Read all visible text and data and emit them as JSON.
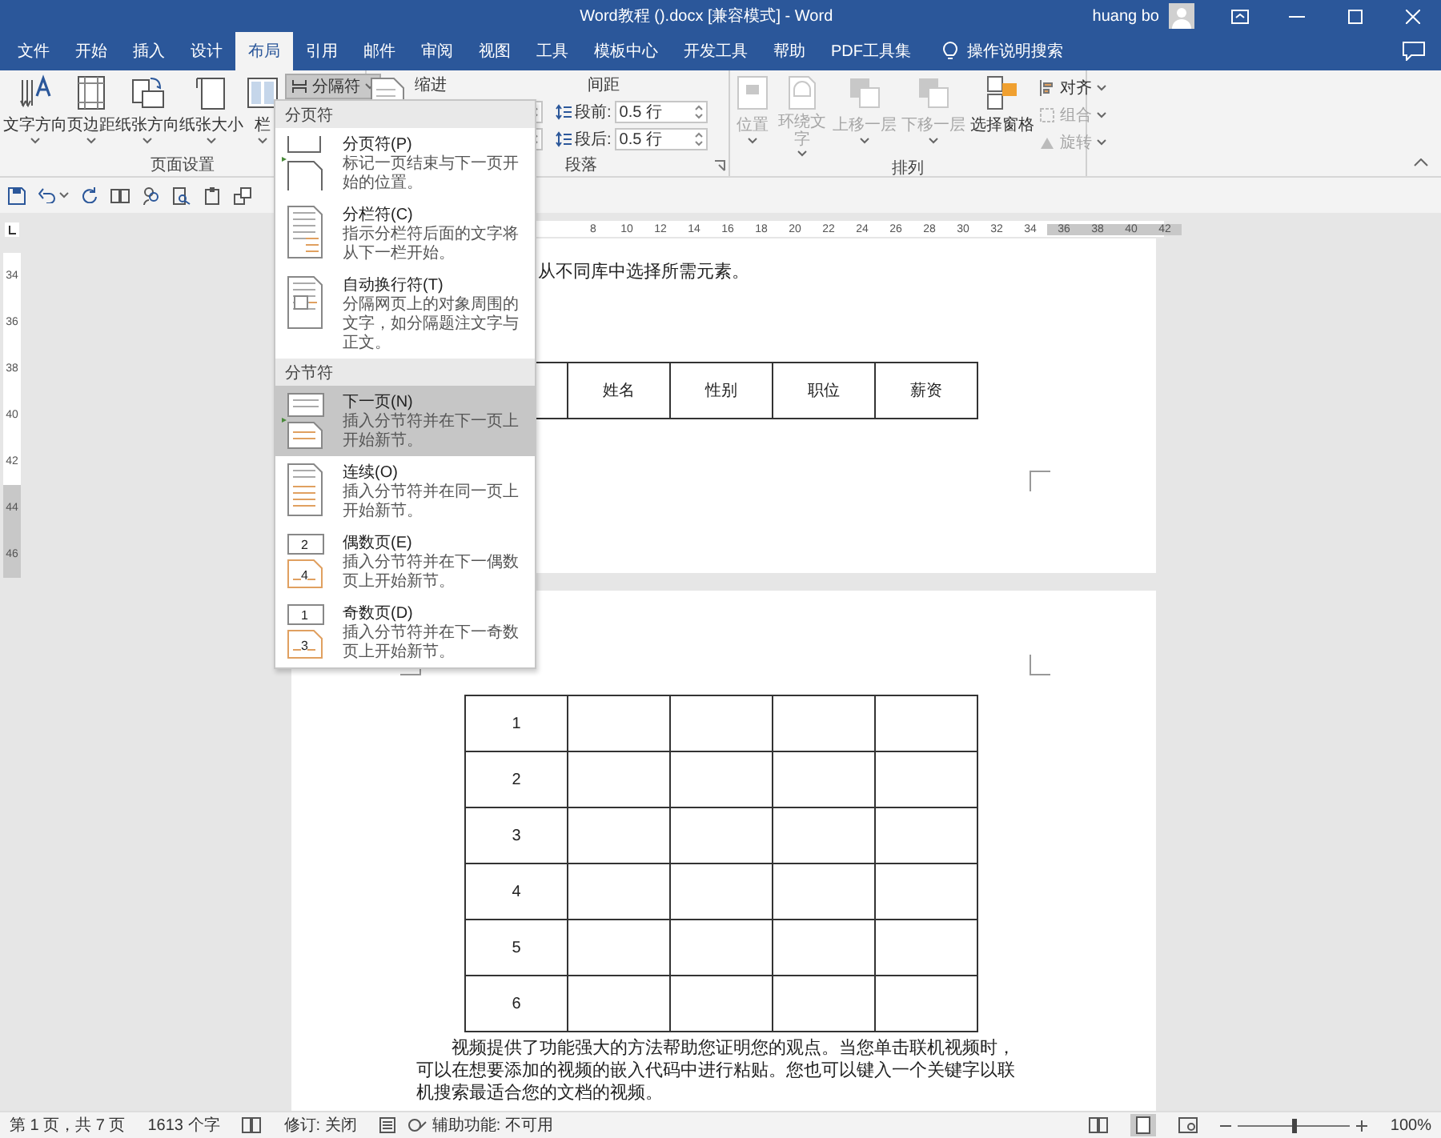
{
  "window": {
    "title": "Word教程 ().docx [兼容模式] - Word",
    "user": "huang bo"
  },
  "tabs": [
    {
      "label": "文件",
      "selected": false
    },
    {
      "label": "开始",
      "selected": false
    },
    {
      "label": "插入",
      "selected": false
    },
    {
      "label": "设计",
      "selected": false
    },
    {
      "label": "布局",
      "selected": true
    },
    {
      "label": "引用",
      "selected": false
    },
    {
      "label": "邮件",
      "selected": false
    },
    {
      "label": "审阅",
      "selected": false
    },
    {
      "label": "视图",
      "selected": false
    },
    {
      "label": "工具",
      "selected": false
    },
    {
      "label": "模板中心",
      "selected": false
    },
    {
      "label": "开发工具",
      "selected": false
    },
    {
      "label": "帮助",
      "selected": false
    },
    {
      "label": "PDF工具集",
      "selected": false
    }
  ],
  "tell_me": "操作说明搜索",
  "page_setup": {
    "label": "页面设置",
    "buttons": [
      "文字方向",
      "页边距",
      "纸张方向",
      "纸张大小",
      "栏"
    ],
    "breaks": "分隔符"
  },
  "paragraph": {
    "label": "段落",
    "indent": "缩进",
    "spacing": "间距",
    "spacing_fields": [
      {
        "label": "段前:",
        "value": "0.5 行"
      },
      {
        "label": "段后:",
        "value": "0.5 行"
      }
    ]
  },
  "arrange": {
    "label": "排列",
    "buttons": [
      {
        "label": "位置",
        "disabled": true
      },
      {
        "label": "环绕文字",
        "disabled": true
      },
      {
        "label": "上移一层",
        "disabled": true
      },
      {
        "label": "下移一层",
        "disabled": true
      },
      {
        "label": "选择窗格",
        "disabled": false
      }
    ],
    "small_buttons": [
      {
        "label": "对齐",
        "disabled": false
      },
      {
        "label": "组合",
        "disabled": true
      },
      {
        "label": "旋转",
        "disabled": true
      }
    ]
  },
  "breaks_menu": {
    "sections": [
      {
        "heading": "分页符",
        "items": [
          {
            "title": "分页符(P)",
            "description": "标记一页结束与下一页开始的位置。",
            "selected": false
          },
          {
            "title": "分栏符(C)",
            "description": "指示分栏符后面的文字将从下一栏开始。",
            "selected": false
          },
          {
            "title": "自动换行符(T)",
            "description": "分隔网页上的对象周围的文字，如分隔题注文字与正文。",
            "selected": false
          }
        ]
      },
      {
        "heading": "分节符",
        "items": [
          {
            "title": "下一页(N)",
            "description": "插入分节符并在下一页上开始新节。",
            "selected": true
          },
          {
            "title": "连续(O)",
            "description": "插入分节符并在同一页上开始新节。",
            "selected": false
          },
          {
            "title": "偶数页(E)",
            "description": "插入分节符并在下一偶数页上开始新节。",
            "selected": false,
            "icon_labels": [
              "2",
              "4"
            ]
          },
          {
            "title": "奇数页(D)",
            "description": "插入分节符并在下一奇数页上开始新节。",
            "selected": false,
            "icon_labels": [
              "1",
              "3"
            ]
          }
        ]
      }
    ]
  },
  "ruler": {
    "horizontal": [
      "8",
      "10",
      "12",
      "14",
      "16",
      "18",
      "20",
      "22",
      "24",
      "26",
      "28",
      "30",
      "32",
      "34",
      "36",
      "38",
      "40",
      "42"
    ],
    "vertical": [
      "34",
      "36",
      "38",
      "40",
      "42",
      "44",
      "46"
    ]
  },
  "page1": {
    "text": "从不同库中选择所需元素。",
    "table_header": [
      "姓名",
      "性别",
      "职位",
      "薪资"
    ]
  },
  "page2": {
    "row_numbers": [
      "1",
      "2",
      "3",
      "4",
      "5",
      "6"
    ],
    "paragraph": "视频提供了功能强大的方法帮助您证明您的观点。当您单击联机视频时，可以在想要添加的视频的嵌入代码中进行粘贴。您也可以键入一个关键字以联机搜索最适合您的文档的视频。"
  },
  "status_bar": {
    "page": "第 1 页，共 7 页",
    "words": "1613 个字",
    "track_changes": "修订: 关闭",
    "accessibility": "辅助功能: 不可用",
    "zoom": "100%",
    "zoom_slider": {
      "level": 0.5
    }
  }
}
